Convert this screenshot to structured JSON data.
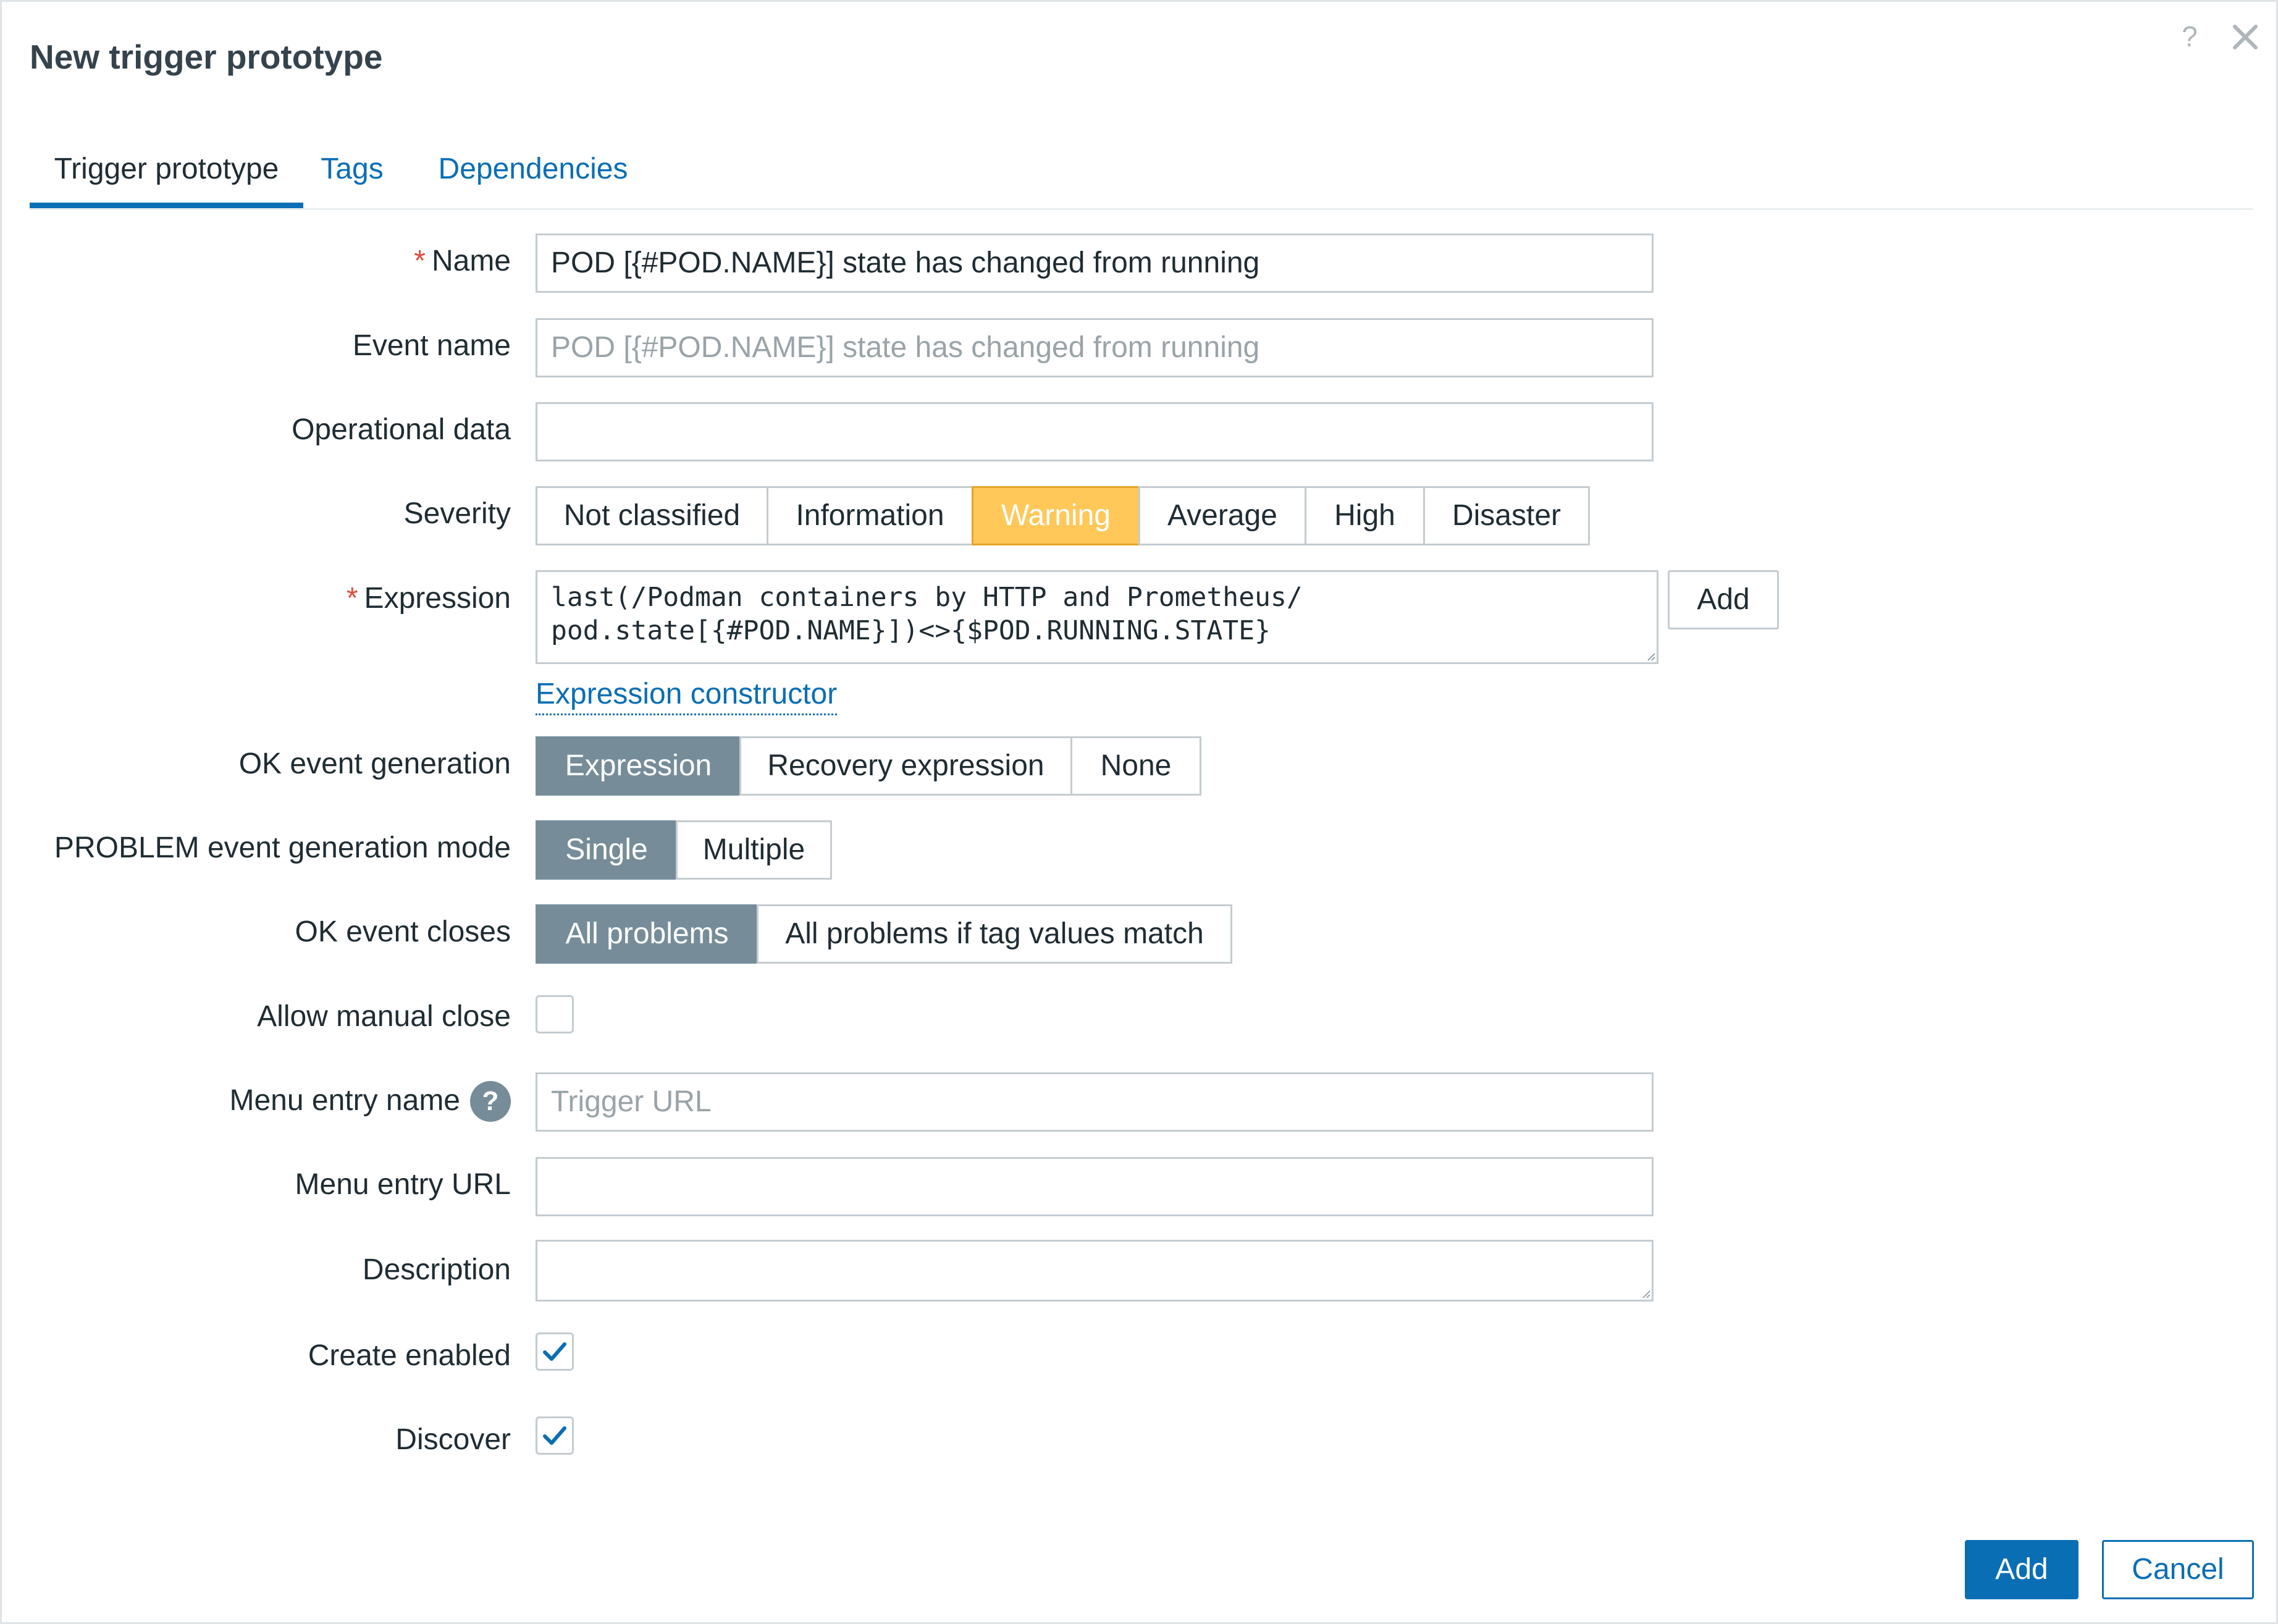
{
  "dialog": {
    "title": "New trigger prototype",
    "help_glyph": "?"
  },
  "tabs": [
    {
      "label": "Trigger prototype",
      "active": true
    },
    {
      "label": "Tags",
      "active": false
    },
    {
      "label": "Dependencies",
      "active": false
    }
  ],
  "form": {
    "name": {
      "label": "Name",
      "required_mark": "*",
      "value": "POD [{#POD.NAME}] state has changed from running"
    },
    "event_name": {
      "label": "Event name",
      "value": "",
      "placeholder": "POD [{#POD.NAME}] state has changed from running"
    },
    "operational_data": {
      "label": "Operational data",
      "value": ""
    },
    "severity": {
      "label": "Severity",
      "options": [
        "Not classified",
        "Information",
        "Warning",
        "Average",
        "High",
        "Disaster"
      ],
      "selected": "Warning"
    },
    "expression": {
      "label": "Expression",
      "required_mark": "*",
      "line1": "last(/Podman containers by HTTP and Prometheus/",
      "line2": "pod.state[{#POD.NAME}])<>{$POD.RUNNING.STATE}",
      "add_label": "Add",
      "constructor_link": "Expression constructor"
    },
    "ok_event_generation": {
      "label": "OK event generation",
      "options": [
        "Expression",
        "Recovery expression",
        "None"
      ],
      "selected": "Expression"
    },
    "problem_mode": {
      "label": "PROBLEM event generation mode",
      "options": [
        "Single",
        "Multiple"
      ],
      "selected": "Single"
    },
    "ok_event_closes": {
      "label": "OK event closes",
      "options": [
        "All problems",
        "All problems if tag values match"
      ],
      "selected": "All problems"
    },
    "allow_manual_close": {
      "label": "Allow manual close",
      "checked": false
    },
    "menu_entry_name": {
      "label": "Menu entry name",
      "help_glyph": "?",
      "value": "",
      "placeholder": "Trigger URL"
    },
    "menu_entry_url": {
      "label": "Menu entry URL",
      "value": ""
    },
    "description": {
      "label": "Description",
      "value": ""
    },
    "create_enabled": {
      "label": "Create enabled",
      "checked": true
    },
    "discover": {
      "label": "Discover",
      "checked": true
    }
  },
  "footer": {
    "add_label": "Add",
    "cancel_label": "Cancel"
  },
  "colors": {
    "accent": "#0a6eb4",
    "warning": "#ffc859",
    "selected_segment": "#768d99",
    "required": "#e04b3a"
  },
  "icons": {
    "close": "close-icon",
    "help": "question-icon",
    "check": "checkmark-icon"
  }
}
